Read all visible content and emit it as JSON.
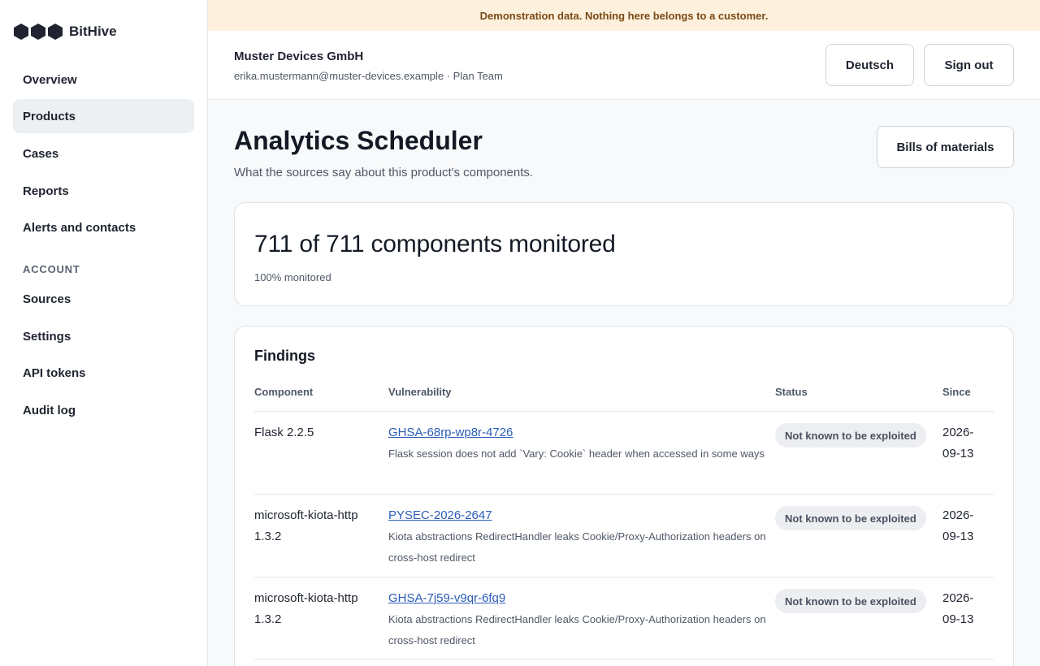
{
  "brand": {
    "name": "BitHive",
    "logo_icon": "hexagons-logo-icon"
  },
  "sidebar": {
    "items": [
      {
        "label": "Overview"
      },
      {
        "label": "Products",
        "active": true
      },
      {
        "label": "Cases"
      },
      {
        "label": "Reports"
      },
      {
        "label": "Alerts and contacts"
      }
    ],
    "section_label": "ACCOUNT",
    "account_items": [
      {
        "label": "Sources"
      },
      {
        "label": "Settings"
      },
      {
        "label": "API tokens"
      },
      {
        "label": "Audit log"
      }
    ]
  },
  "banner": {
    "text": "Demonstration data. Nothing here belongs to a customer."
  },
  "header": {
    "org_name": "Muster Devices GmbH",
    "org_sub": "erika.mustermann@muster-devices.example · Plan Team",
    "language_label": "Deutsch",
    "signout_label": "Sign out"
  },
  "main": {
    "title": "Analytics Scheduler",
    "subtitle": "What the sources say about this product's components.",
    "bom_label": "Bills of materials",
    "summary": {
      "title": "711 of 711 components monitored",
      "sub": "100% monitored",
      "monitored_percent": 100
    },
    "findings": {
      "title": "Findings",
      "columns": {
        "component": "Component",
        "vulnerability": "Vulnerability",
        "status": "Status",
        "since": "Since"
      },
      "rows": [
        {
          "component": "Flask 2.2.5",
          "id": "GHSA-68rp-wp8r-4726",
          "description": "Flask session does not add `Vary: Cookie` header when accessed in some ways",
          "status": "Not known to be exploited",
          "since": "2026-09-13"
        },
        {
          "component": "microsoft-kiota-http 1.3.2",
          "id": "PYSEC-2026-2647",
          "description": "Kiota abstractions RedirectHandler leaks Cookie/Proxy-Authorization headers on cross-host redirect",
          "status": "Not known to be exploited",
          "since": "2026-09-13"
        },
        {
          "component": "microsoft-kiota-http 1.3.2",
          "id": "GHSA-7j59-v9qr-6fq9",
          "description": "Kiota abstractions RedirectHandler leaks Cookie/Proxy-Authorization headers on cross-host redirect",
          "status": "Not known to be exploited",
          "since": "2026-09-13"
        }
      ]
    }
  },
  "colors": {
    "banner_bg": "#fdf0dd",
    "banner_text": "#7a4a16",
    "link": "#2a5cb8",
    "active_nav_bg": "#edf0f3",
    "badge_bg": "#eceef1"
  }
}
